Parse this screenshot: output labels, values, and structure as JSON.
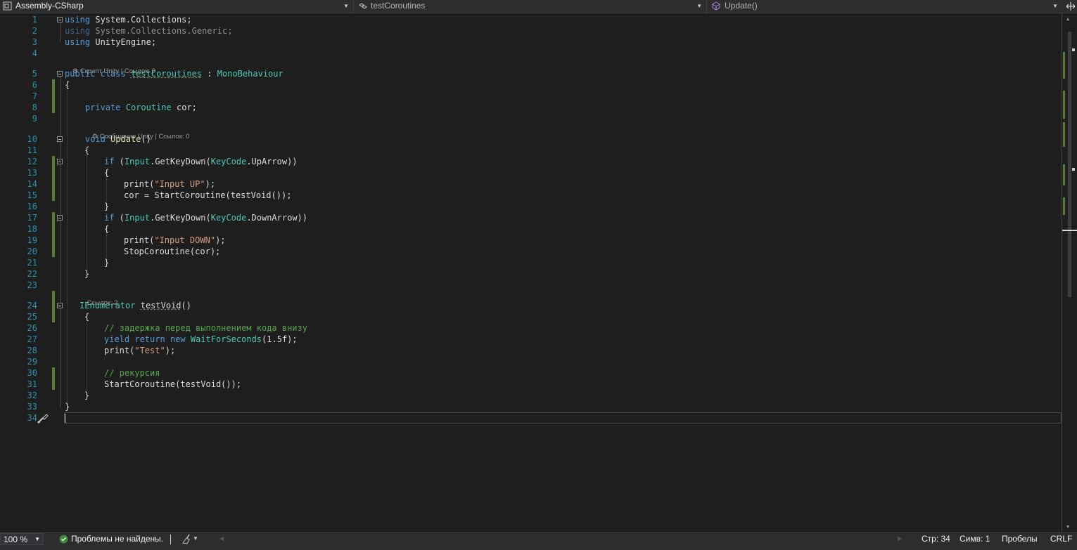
{
  "navbar": {
    "project": "Assembly-CSharp",
    "class_scope": "testCoroutines",
    "member_scope": "Update()"
  },
  "editor": {
    "line_numbers": [
      "1",
      "2",
      "3",
      "4",
      "5",
      "6",
      "7",
      "8",
      "9",
      "10",
      "11",
      "12",
      "13",
      "14",
      "15",
      "16",
      "17",
      "18",
      "19",
      "20",
      "21",
      "22",
      "23",
      "24",
      "25",
      "26",
      "27",
      "28",
      "29",
      "30",
      "31",
      "32",
      "33",
      "34"
    ],
    "codelens": {
      "class": "Скрипт Unity | Ссылок: 0",
      "update": "Сообщение Unity | Ссылок: 0",
      "testvoid": "Ссылок: 2"
    },
    "lines": {
      "l1": {
        "kw": "using",
        "rest": " System.Collections;"
      },
      "l2": {
        "kw": "using",
        "rest": " System.Collections.Generic;"
      },
      "l3": {
        "kw": "using",
        "rest": " UnityEngine;"
      },
      "l5": {
        "kw1": "public",
        "kw2": "class",
        "name": "testCoroutines",
        "colon": " : ",
        "base": "MonoBehaviour"
      },
      "l6": "{",
      "l8": {
        "kw": "private",
        "type": "Coroutine",
        "rest": " cor;"
      },
      "l10": {
        "kw": "void",
        "name": "Update",
        "rest": "()"
      },
      "l11": "{",
      "l12": {
        "kw": "if",
        "p1": " (",
        "type1": "Input",
        "p2": ".GetKeyDown(",
        "type2": "KeyCode",
        "p3": ".UpArrow))"
      },
      "l13": "{",
      "l14": {
        "fn": "print(",
        "str": "\"Input UP\"",
        "end": ");"
      },
      "l15": "cor = StartCoroutine(testVoid());",
      "l16": "}",
      "l17": {
        "kw": "if",
        "p1": " (",
        "type1": "Input",
        "p2": ".GetKeyDown(",
        "type2": "KeyCode",
        "p3": ".DownArrow))"
      },
      "l18": "{",
      "l19": {
        "fn": "print(",
        "str": "\"Input DOWN\"",
        "end": ");"
      },
      "l20": "StopCoroutine(cor);",
      "l21": "}",
      "l22": "}",
      "l24": {
        "type": "IEnumerator",
        "name": "testVoid",
        "rest": "()"
      },
      "l25": "{",
      "l26": "// задержка перед выполнением кода внизу",
      "l27": {
        "kw1": "yield",
        "kw2": "return",
        "kw3": "new",
        "type": "WaitForSeconds",
        "p1": "(",
        "num": "1.5f",
        "p2": ");"
      },
      "l28": {
        "fn": "print(",
        "str": "\"Test\"",
        "end": ");"
      },
      "l30": "// рекурсия",
      "l31": "StartCoroutine(testVoid());",
      "l32": "}",
      "l33": "}"
    }
  },
  "statusbar": {
    "zoom": "100 %",
    "issues": "Проблемы не найдены.",
    "line": "Стр: 34",
    "column": "Симв: 1",
    "indent": "Пробелы",
    "eol": "CRLF"
  },
  "colors": {
    "background": "#1e1e1e",
    "keyword": "#569cd6",
    "type": "#4ec9b0",
    "string": "#d69d85",
    "comment": "#57a64a",
    "line_number": "#2b91af",
    "change_marker": "#5b7a34"
  },
  "icons": {
    "project": "csharp-project-icon",
    "class": "class-icon",
    "member": "method-icon",
    "issues": "check-circle-icon",
    "cleanup": "brush-icon",
    "quick_action": "screwdriver-brush-icon"
  }
}
